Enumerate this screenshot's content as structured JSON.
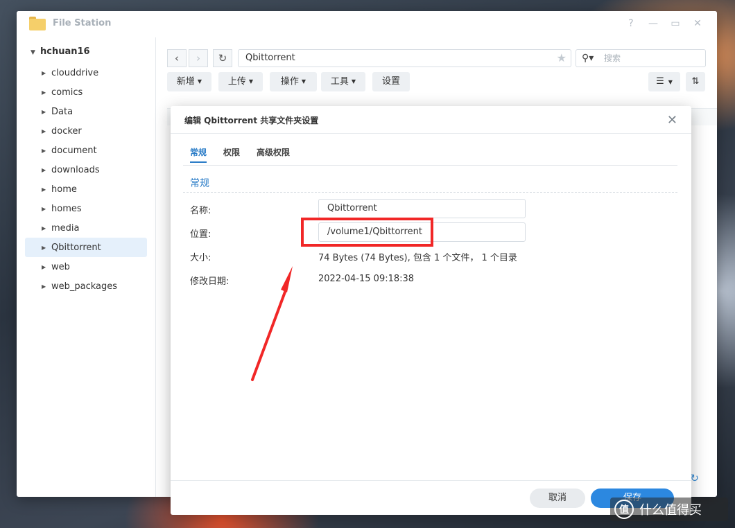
{
  "window": {
    "title": "File Station",
    "controls": {
      "help": "?",
      "minimize": "—",
      "maximize": "▭",
      "close": "✕"
    }
  },
  "sidebar": {
    "root": "hchuan16",
    "items": [
      {
        "label": "clouddrive"
      },
      {
        "label": "comics"
      },
      {
        "label": "Data"
      },
      {
        "label": "docker"
      },
      {
        "label": "document"
      },
      {
        "label": "downloads"
      },
      {
        "label": "home"
      },
      {
        "label": "homes"
      },
      {
        "label": "media"
      },
      {
        "label": "Qbittorrent",
        "selected": true
      },
      {
        "label": "web"
      },
      {
        "label": "web_packages"
      }
    ]
  },
  "toolbar": {
    "path": "Qbittorrent",
    "search_placeholder": "搜索",
    "buttons": {
      "new": "新增",
      "upload": "上传",
      "action": "操作",
      "tools": "工具",
      "settings": "设置"
    }
  },
  "dialog": {
    "title": "编辑 Qbittorrent 共享文件夹设置",
    "tabs": [
      "常规",
      "权限",
      "高级权限"
    ],
    "active_tab": "常规",
    "section": "常规",
    "fields": {
      "name_label": "名称:",
      "name_value": "Qbittorrent",
      "location_label": "位置:",
      "location_value": "/volume1/Qbittorrent",
      "size_label": "大小:",
      "size_value": "74 Bytes (74 Bytes), 包含 1 个文件， 1 个目录",
      "modified_label": "修改日期:",
      "modified_value": "2022-04-15 09:18:38"
    },
    "buttons": {
      "cancel": "取消",
      "save": "保存"
    }
  },
  "annotation": {
    "color": "#f12727"
  },
  "watermark": {
    "badge": "值",
    "text": "什么值得买"
  },
  "colors": {
    "accent": "#2c88e0",
    "selected_bg": "#e5f0fb"
  }
}
